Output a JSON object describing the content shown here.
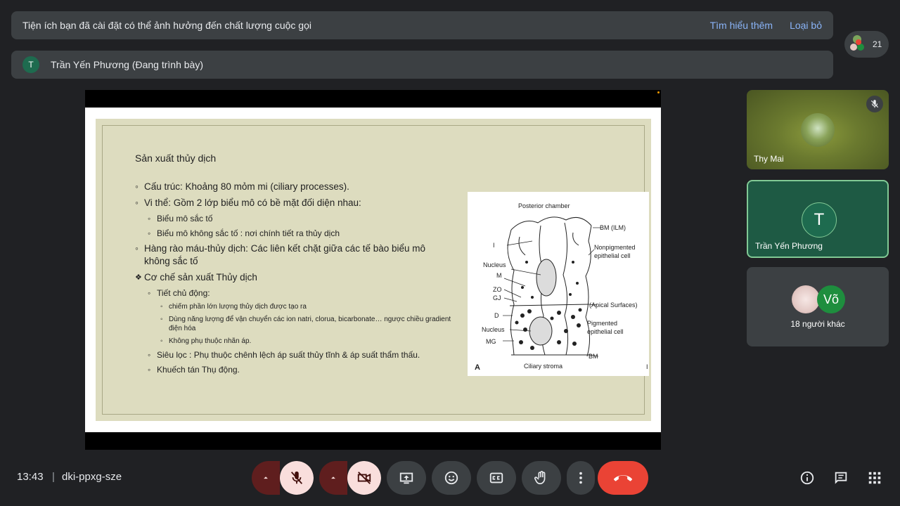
{
  "banner": {
    "message": "Tiện ích bạn đã cài đặt có thể ảnh hưởng đến chất lượng cuộc gọi",
    "learn_more": "Tìm hiểu thêm",
    "dismiss": "Loại bỏ"
  },
  "presenter": {
    "initial": "T",
    "label": "Trần Yến Phương (Đang trình bày)"
  },
  "participants": {
    "count": "21"
  },
  "slide": {
    "title": "Sản xuất thủy dịch",
    "items": [
      "Cấu trúc: Khoảng 80 mỏm mi (ciliary processes).",
      "Vi thể: Gồm 2 lớp biểu mô có bề mặt đối diện nhau:",
      "Biểu mô sắc tố",
      "Biểu mô không sắc tố : nơi chính tiết ra thủy dịch",
      "Hàng rào máu-thủy dịch: Các liên kết chặt giữa các tế bào biểu mô không sắc tố",
      "Cơ chế sản xuất Thủy dịch",
      "Tiết chủ động:",
      "chiếm phần lớn lượng thủy dịch được tạo ra",
      "Dùng năng lượng để vận chuyển các ion natri, clorua, bicarbonate… ngược chiều gradient điện hóa",
      "Không phụ thuộc nhãn áp.",
      "Siêu lọc : Phụ thuộc chênh lệch áp suất thủy tĩnh & áp suất thẩm thấu.",
      "Khuếch tán  Thụ động."
    ],
    "diagram": {
      "top": "Posterior chamber",
      "bm_ilm": "BM (ILM)",
      "i": "I",
      "nonpig1": "Nonpigmented",
      "nonpig2": "epithelial cell",
      "nucleus": "Nucleus",
      "m": "M",
      "zo": "ZO",
      "gj": "GJ",
      "apical": "(Apical Surfaces)",
      "d": "D",
      "nucleus2": "Nucleus",
      "pig1": "Pigmented",
      "pig2": "epithelial cell",
      "mg": "MG",
      "bm": "BM",
      "a": "A",
      "stroma": "Ciliary stroma",
      "bar": "I"
    }
  },
  "tiles": {
    "t1": "Thy Mai",
    "t2_initial": "T",
    "t2": "Trần Yến Phương",
    "t3_initial": "Võ",
    "t3": "18 người khác"
  },
  "footer": {
    "time": "13:43",
    "separator": "|",
    "meeting_code": "dki-ppxg-sze"
  },
  "colors": {
    "background": "#202124",
    "surface": "#3c4043",
    "accent_link": "#8ab4f8",
    "end_call": "#ea4335",
    "muted_button": "#f9dedc",
    "speaker_tile": "#1e5a44"
  },
  "icons": [
    "mic-off-icon",
    "camera-off-icon",
    "present-icon",
    "emoji-icon",
    "captions-icon",
    "raise-hand-icon",
    "more-icon",
    "call-end-icon",
    "info-icon",
    "chat-icon",
    "apps-icon"
  ]
}
